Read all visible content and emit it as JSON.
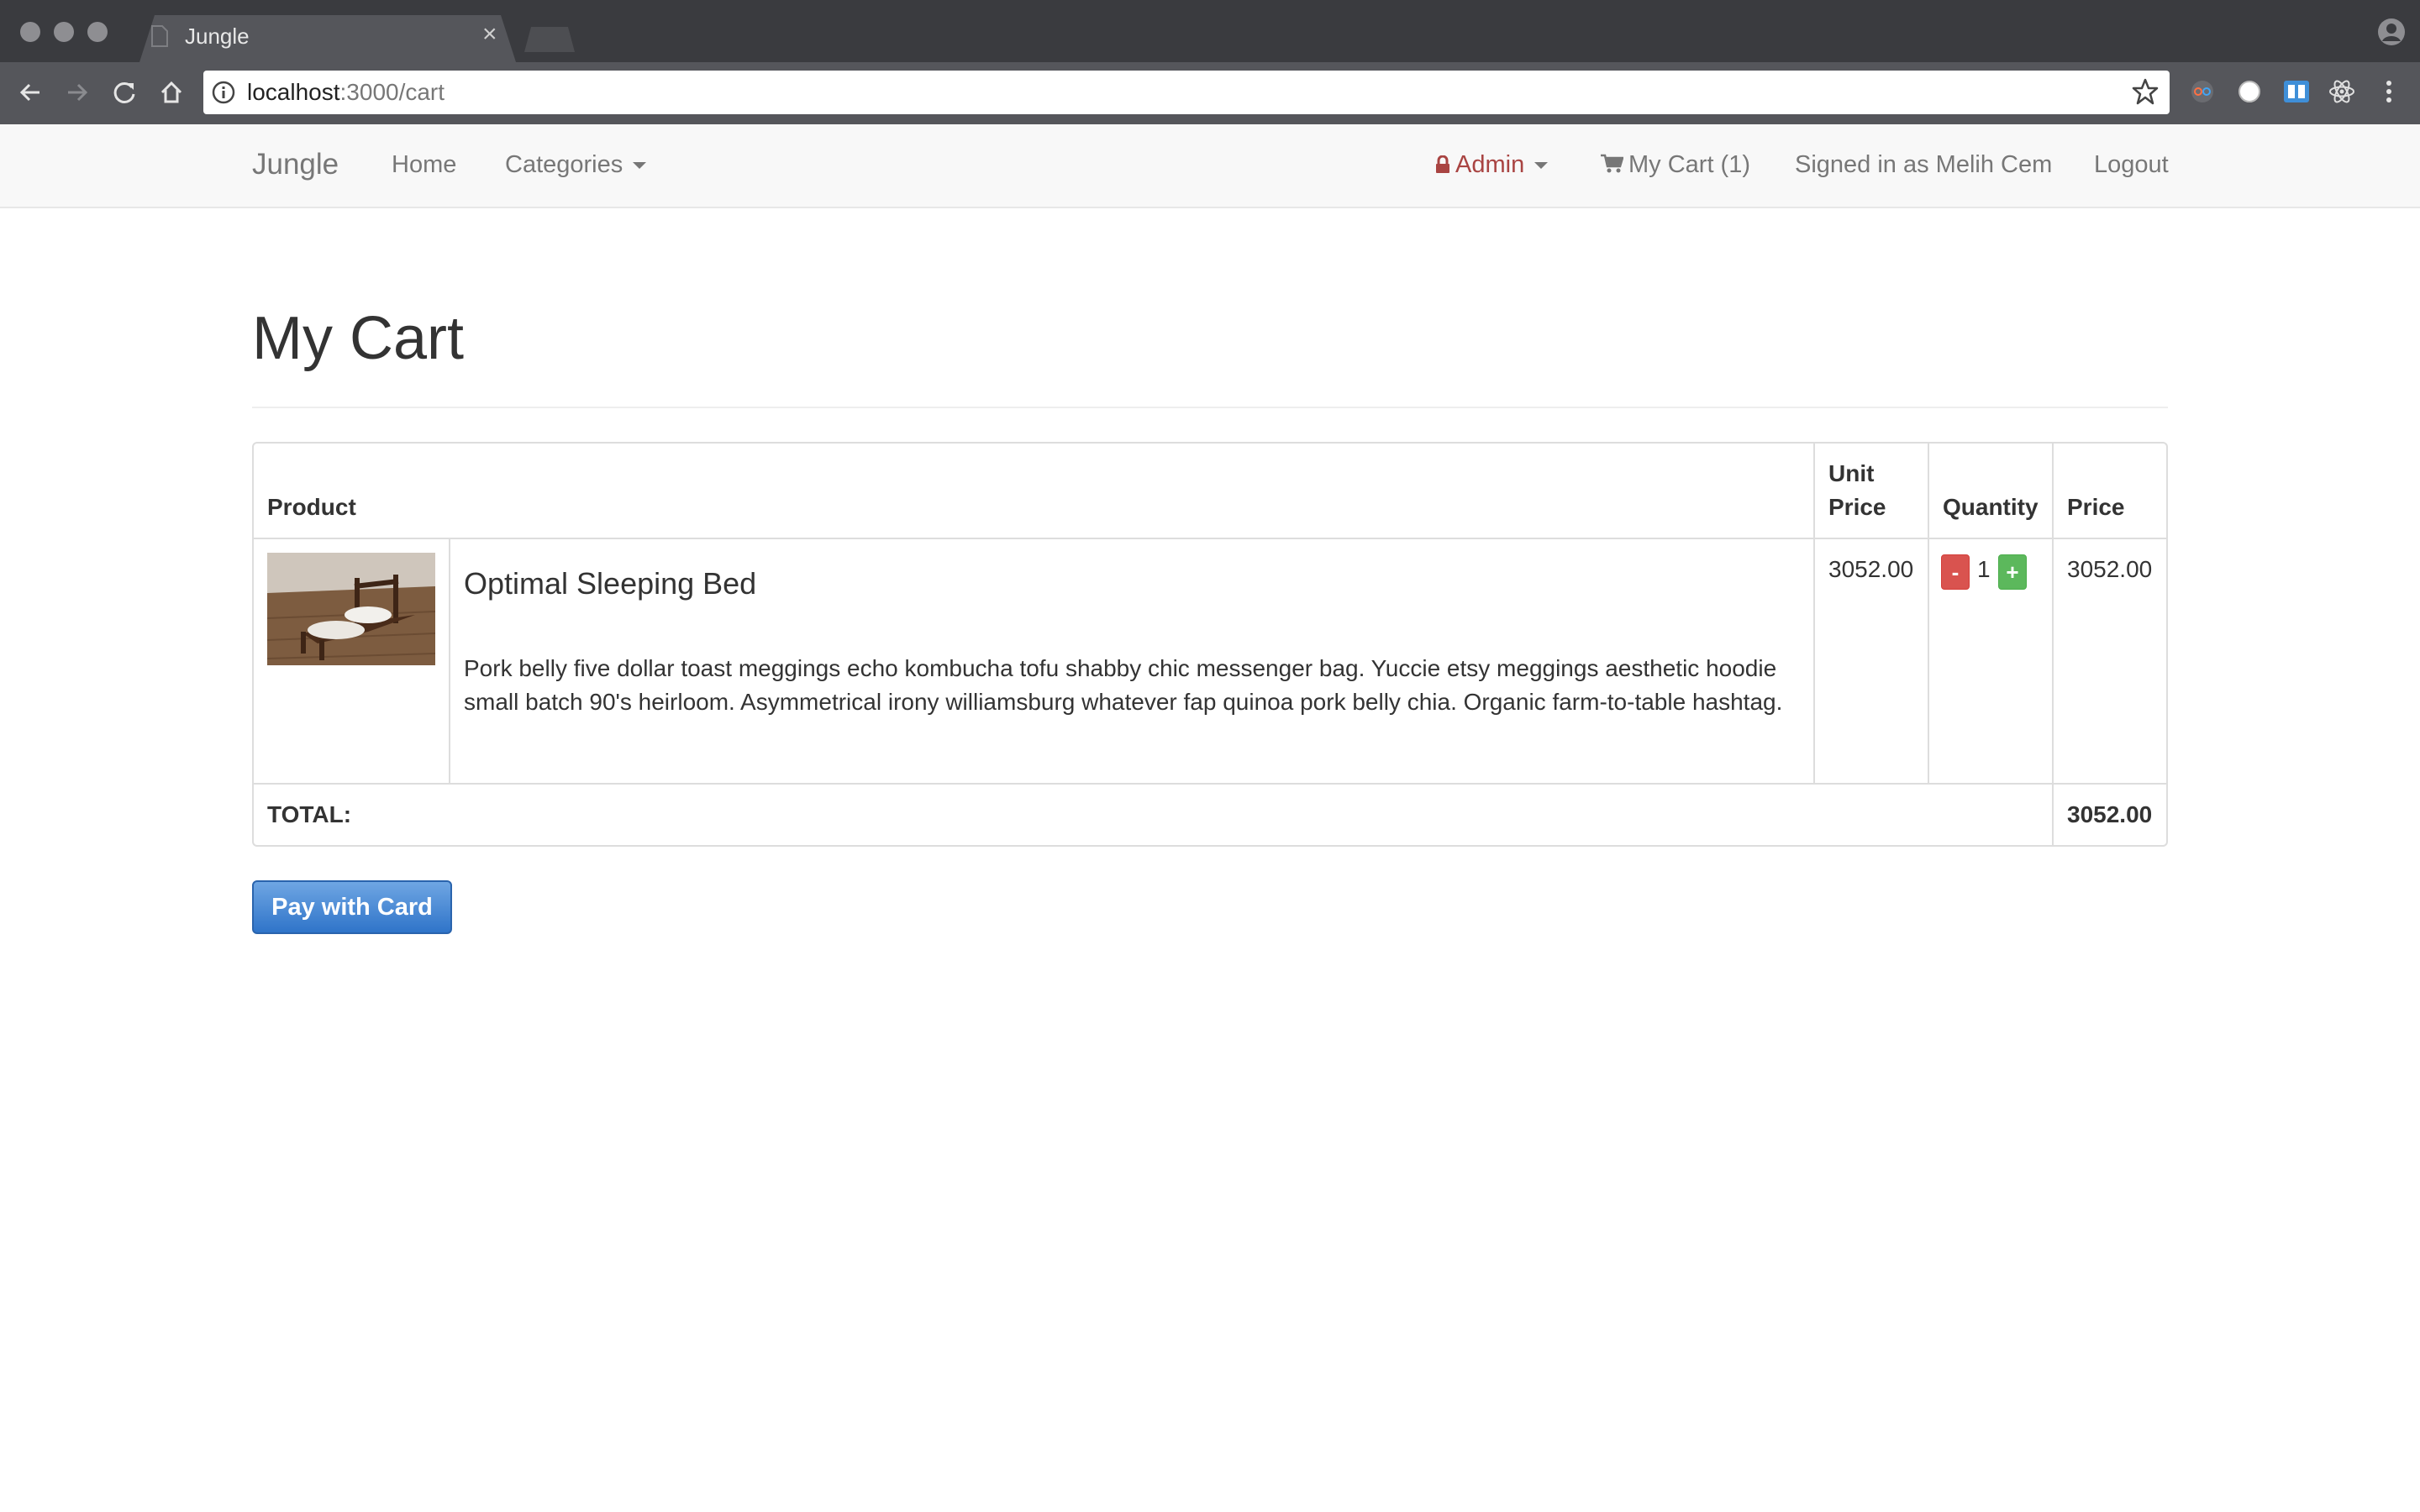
{
  "browser": {
    "tab_title": "Jungle",
    "tab_close": "×",
    "url_host": "localhost",
    "url_path": ":3000/cart"
  },
  "navbar": {
    "brand": "Jungle",
    "home": "Home",
    "categories": "Categories",
    "admin": "Admin",
    "cart": "My Cart (1)",
    "signed_in": "Signed in as Melih Cem",
    "logout": "Logout"
  },
  "page": {
    "title": "My Cart"
  },
  "cart": {
    "headers": {
      "product": "Product",
      "unit_price_line1": "Unit",
      "unit_price_line2": "Price",
      "quantity": "Quantity",
      "price": "Price"
    },
    "items": [
      {
        "name": "Optimal Sleeping Bed",
        "description": "Pork belly five dollar toast meggings echo kombucha tofu shabby chic messenger bag. Yuccie etsy meggings aesthetic hoodie small batch 90's heirloom. Asymmetrical irony williamsburg whatever fap quinoa pork belly chia. Organic farm-to-table hashtag.",
        "unit_price": "3052.00",
        "quantity": "1",
        "minus_label": "-",
        "plus_label": "+",
        "price": "3052.00"
      }
    ],
    "total_label": "TOTAL:",
    "total": "3052.00"
  },
  "pay_button": "Pay with Card",
  "colors": {
    "danger": "#d9534f",
    "success": "#5cb85c",
    "primary": "#337ab7",
    "admin_text": "#a94442"
  }
}
